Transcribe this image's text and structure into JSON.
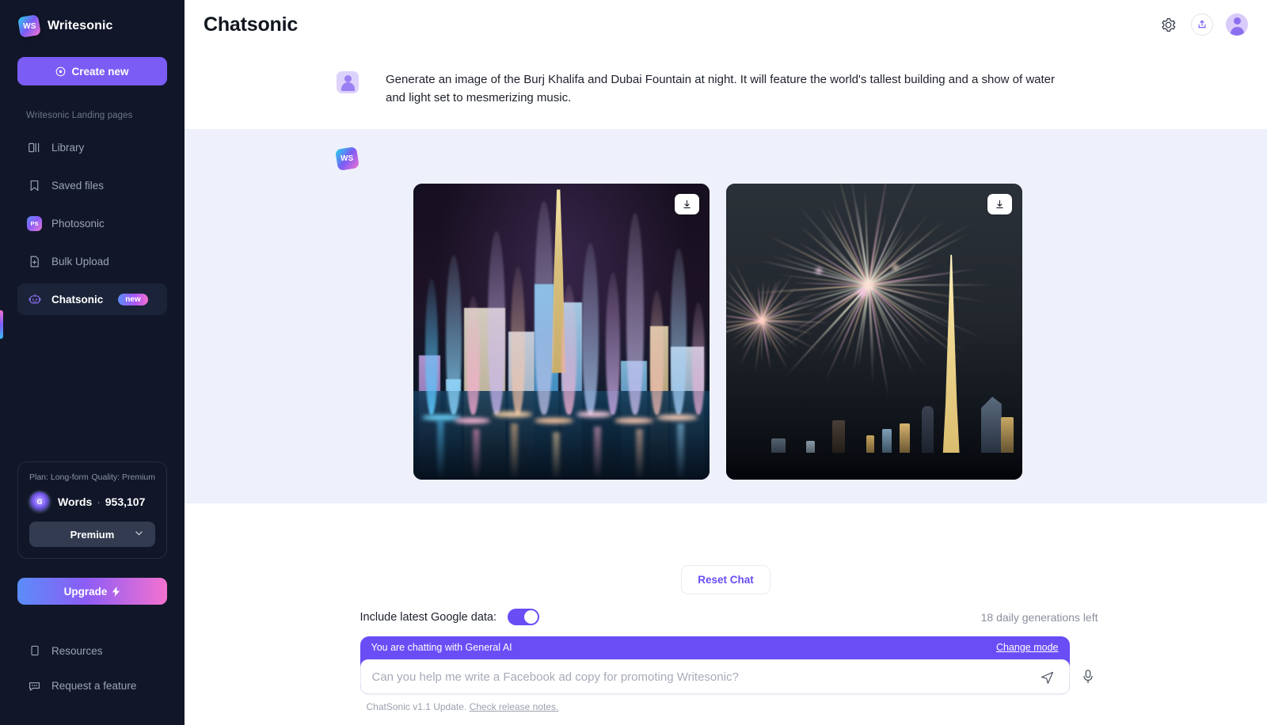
{
  "brand": {
    "name": "Writesonic",
    "mark_text": "WS"
  },
  "sidebar": {
    "create_new_label": "Create new",
    "section_label": "Writesonic Landing pages",
    "items": [
      {
        "label": "Library",
        "icon": "library-icon"
      },
      {
        "label": "Saved files",
        "icon": "bookmark-icon"
      },
      {
        "label": "Photosonic",
        "icon": "photosonic-icon"
      },
      {
        "label": "Bulk Upload",
        "icon": "file-plus-icon"
      },
      {
        "label": "Chatsonic",
        "icon": "robot-icon",
        "badge": "new",
        "active": true
      }
    ],
    "plan": {
      "plan_text": "Plan: Long-form",
      "quality_text": "Quality: Premium",
      "words_label": "Words",
      "words_value": "953,107",
      "orb_text": "G",
      "quality_select": "Premium"
    },
    "upgrade_label": "Upgrade",
    "footer_items": [
      {
        "label": "Resources",
        "icon": "book-icon"
      },
      {
        "label": "Request a feature",
        "icon": "chat-dots-icon"
      }
    ]
  },
  "header": {
    "title": "Chatsonic",
    "settings_icon": "gear-icon",
    "share_icon": "share-upload-icon",
    "avatar_icon": "user-avatar"
  },
  "conversation": {
    "user_message": "Generate an image of the Burj Khalifa and Dubai Fountain at night. It will feature the world's tallest building and a show of water and light set to mesmerizing music.",
    "bot_mark_text": "WS",
    "images": [
      {
        "alt": "Dubai Fountain light show at night with Burj Khalifa",
        "download_icon": "download-icon"
      },
      {
        "alt": "Fireworks over Burj Khalifa at night",
        "download_icon": "download-icon"
      }
    ]
  },
  "composer": {
    "reset_label": "Reset Chat",
    "google_data_label": "Include latest Google data:",
    "google_data_on": true,
    "generations_left": "18 daily generations left",
    "mode_text": "You are chatting with General AI",
    "change_mode_label": "Change mode",
    "input_value": "",
    "input_placeholder": "Can you help me write a Facebook ad copy for promoting Writesonic?",
    "mic_icon": "microphone-icon",
    "send_icon": "send-icon",
    "release_prefix": "ChatSonic v1.1 Update. ",
    "release_link": "Check release notes."
  },
  "colors": {
    "sidebar_bg": "#111729",
    "accent_purple": "#6b4df6",
    "bot_bubble_bg": "#eef1fc",
    "title_color": "#12161f"
  }
}
